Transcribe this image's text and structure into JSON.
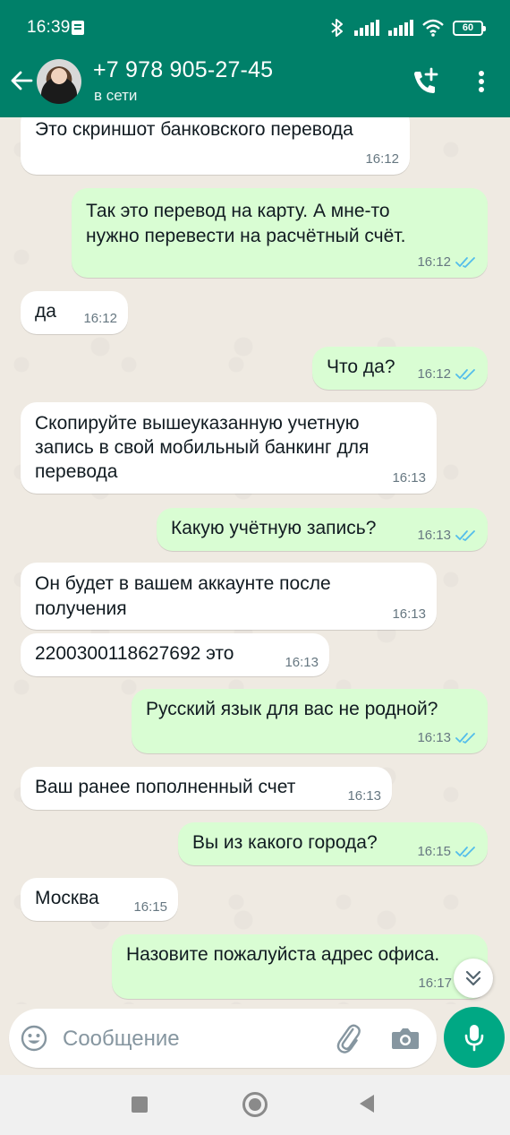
{
  "status_bar": {
    "time": "16:39",
    "battery": "60"
  },
  "header": {
    "contact_name": "+7 978 905-27-45",
    "contact_status": "в сети",
    "icons": [
      "back-arrow-icon",
      "add-call-icon",
      "more-vert-icon"
    ]
  },
  "messages": [
    {
      "dir": "in",
      "text": "Это скриншот банковского перевода",
      "time": "16:12"
    },
    {
      "dir": "out",
      "text": "Так это перевод на карту. А мне-то\nнужно перевести на расчётный счёт.",
      "time": "16:12",
      "status": "read"
    },
    {
      "dir": "in",
      "text": "да",
      "time": "16:12"
    },
    {
      "dir": "out",
      "text": "Что да?",
      "time": "16:12",
      "status": "read"
    },
    {
      "dir": "in",
      "text": "Скопируйте вышеуказанную учетную\nзапись в свой мобильный банкинг для\nперевода",
      "time": "16:13"
    },
    {
      "dir": "out",
      "text": "Какую учётную запись?",
      "time": "16:13",
      "status": "read"
    },
    {
      "dir": "in",
      "text": "Он будет в вашем аккаунте после\nполучения",
      "time": "16:13"
    },
    {
      "dir": "in",
      "text": "2200300118627692 это",
      "time": "16:13"
    },
    {
      "dir": "out",
      "text": "Русский язык для вас не родной?",
      "time": "16:13",
      "status": "read"
    },
    {
      "dir": "in",
      "text": "Ваш ранее пополненный счет",
      "time": "16:13"
    },
    {
      "dir": "out",
      "text": "Вы из какого города?",
      "time": "16:15",
      "status": "read"
    },
    {
      "dir": "in",
      "text": "Москва",
      "time": "16:15"
    },
    {
      "dir": "out",
      "text": "Назовите пожалуйста адрес офиса.",
      "time": "16:17"
    }
  ],
  "composer": {
    "placeholder": "Сообщение",
    "value": ""
  },
  "colors": {
    "header": "#008069",
    "chat_bg": "#efeae2",
    "incoming_bubble": "#ffffff",
    "outgoing_bubble": "#d9fdd3",
    "read_ticks": "#53bdeb",
    "mic_button": "#00a884"
  }
}
